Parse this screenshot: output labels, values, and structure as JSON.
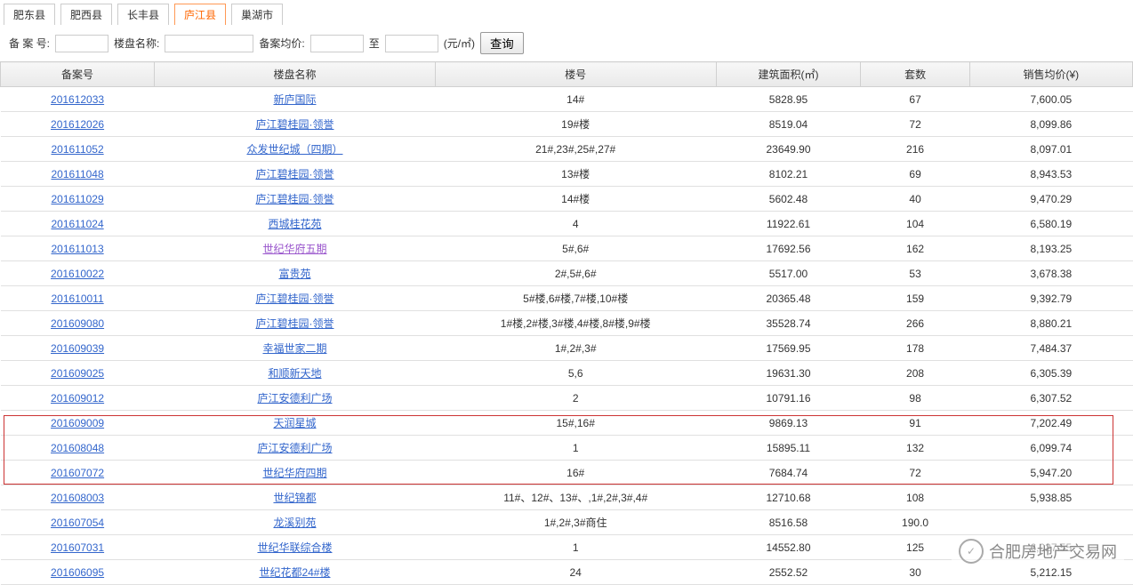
{
  "tabs": [
    "肥东县",
    "肥西县",
    "长丰县",
    "庐江县",
    "巢湖市"
  ],
  "activeTab": 3,
  "filter": {
    "recordNo": "备 案 号:",
    "projectName": "楼盘名称:",
    "avgPrice": "备案均价:",
    "to": "至",
    "unit": "(元/㎡)",
    "queryBtn": "查询"
  },
  "headers": [
    "备案号",
    "楼盘名称",
    "楼号",
    "建筑面积(㎡)",
    "套数",
    "销售均价(¥)"
  ],
  "rows": [
    {
      "id": "201612033",
      "name": "新庐国际",
      "bld": "14#",
      "area": "5828.95",
      "cnt": "67",
      "price": "7,600.05"
    },
    {
      "id": "201612026",
      "name": "庐江碧桂园·领誉",
      "bld": "19#楼",
      "area": "8519.04",
      "cnt": "72",
      "price": "8,099.86"
    },
    {
      "id": "201611052",
      "name": "众发世纪城（四期）",
      "bld": "21#,23#,25#,27#",
      "area": "23649.90",
      "cnt": "216",
      "price": "8,097.01"
    },
    {
      "id": "201611048",
      "name": "庐江碧桂园·领誉",
      "bld": "13#楼",
      "area": "8102.21",
      "cnt": "69",
      "price": "8,943.53"
    },
    {
      "id": "201611029",
      "name": "庐江碧桂园·领誉",
      "bld": "14#楼",
      "area": "5602.48",
      "cnt": "40",
      "price": "9,470.29"
    },
    {
      "id": "201611024",
      "name": "西城桂花苑",
      "bld": "4",
      "area": "11922.61",
      "cnt": "104",
      "price": "6,580.19"
    },
    {
      "id": "201611013",
      "name": "世纪华府五期",
      "visited": true,
      "bld": "5#,6#",
      "area": "17692.56",
      "cnt": "162",
      "price": "8,193.25"
    },
    {
      "id": "201610022",
      "name": "富贵苑",
      "bld": "2#,5#,6#",
      "area": "5517.00",
      "cnt": "53",
      "price": "3,678.38"
    },
    {
      "id": "201610011",
      "name": "庐江碧桂园·领誉",
      "bld": "5#楼,6#楼,7#楼,10#楼",
      "area": "20365.48",
      "cnt": "159",
      "price": "9,392.79"
    },
    {
      "id": "201609080",
      "name": "庐江碧桂园·领誉",
      "bld": "1#楼,2#楼,3#楼,4#楼,8#楼,9#楼",
      "area": "35528.74",
      "cnt": "266",
      "price": "8,880.21"
    },
    {
      "id": "201609039",
      "name": "幸福世家二期",
      "bld": "1#,2#,3#",
      "area": "17569.95",
      "cnt": "178",
      "price": "7,484.37"
    },
    {
      "id": "201609025",
      "name": "和顺新天地",
      "bld": "5,6",
      "area": "19631.30",
      "cnt": "208",
      "price": "6,305.39"
    },
    {
      "id": "201609012",
      "name": "庐江安德利广场",
      "bld": "2",
      "area": "10791.16",
      "cnt": "98",
      "price": "6,307.52"
    },
    {
      "id": "201609009",
      "name": "天润星城",
      "bld": "15#,16#",
      "area": "9869.13",
      "cnt": "91",
      "price": "7,202.49"
    },
    {
      "id": "201608048",
      "name": "庐江安德利广场",
      "bld": "1",
      "area": "15895.11",
      "cnt": "132",
      "price": "6,099.74"
    },
    {
      "id": "201607072",
      "name": "世纪华府四期",
      "bld": "16#",
      "area": "7684.74",
      "cnt": "72",
      "price": "5,947.20"
    },
    {
      "id": "201608003",
      "name": "世纪锦都",
      "bld": "11#、12#、13#、,1#,2#,3#,4#",
      "area": "12710.68",
      "cnt": "108",
      "price": "5,938.85"
    },
    {
      "id": "201607054",
      "name": "龙溪别苑",
      "bld": "1#,2#,3#商住",
      "area": "8516.58",
      "cnt": "190.0",
      "price": ""
    },
    {
      "id": "201607031",
      "name": "世纪华联综合楼",
      "bld": "1",
      "area": "14552.80",
      "cnt": "125",
      "price": "6,027.55"
    },
    {
      "id": "201606095",
      "name": "世纪花都24#楼",
      "bld": "24",
      "area": "2552.52",
      "cnt": "30",
      "price": "5,212.15"
    }
  ],
  "wechat": "合肥房地产交易网"
}
